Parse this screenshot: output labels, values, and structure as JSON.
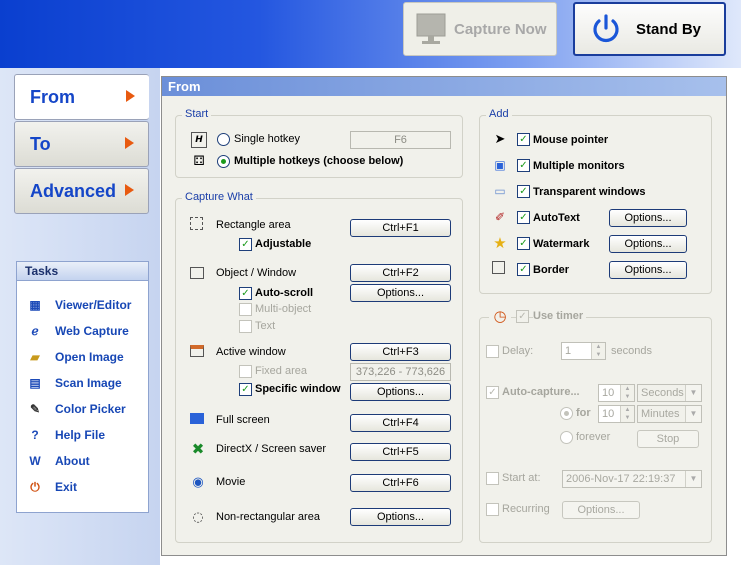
{
  "toolbar": {
    "capture_now": "Capture Now",
    "stand_by": "Stand By"
  },
  "nav": {
    "from": "From",
    "to": "To",
    "advanced": "Advanced"
  },
  "tasks": {
    "title": "Tasks",
    "items": [
      {
        "label": "Viewer/Editor",
        "icon": "viewer-icon"
      },
      {
        "label": "Web Capture",
        "icon": "web-icon"
      },
      {
        "label": "Open Image",
        "icon": "folder-icon"
      },
      {
        "label": "Scan Image",
        "icon": "scanner-icon"
      },
      {
        "label": "Color Picker",
        "icon": "dropper-icon"
      },
      {
        "label": "Help File",
        "icon": "help-icon"
      },
      {
        "label": "About",
        "icon": "about-icon"
      },
      {
        "label": "Exit",
        "icon": "exit-icon"
      }
    ]
  },
  "panel": {
    "title": "From"
  },
  "start": {
    "title": "Start",
    "single_hotkey": "Single hotkey",
    "single_value": "F6",
    "multiple_hotkeys": "Multiple hotkeys  (choose below)"
  },
  "capture": {
    "title": "Capture What",
    "rectangle": "Rectangle area",
    "rectangle_key": "Ctrl+F1",
    "adjustable": "Adjustable",
    "object": "Object / Window",
    "object_key": "Ctrl+F2",
    "auto_scroll": "Auto-scroll",
    "options": "Options...",
    "multi_object": "Multi-object",
    "text": "Text",
    "active": "Active window",
    "active_key": "Ctrl+F3",
    "fixed_area": "Fixed area",
    "fixed_value": "373,226 - 773,626",
    "specific_window": "Specific window",
    "full_screen": "Full screen",
    "full_key": "Ctrl+F4",
    "directx": "DirectX / Screen saver",
    "directx_key": "Ctrl+F5",
    "movie": "Movie",
    "movie_key": "Ctrl+F6",
    "nonrect": "Non-rectangular area"
  },
  "add": {
    "title": "Add",
    "mouse_pointer": "Mouse pointer",
    "multiple_monitors": "Multiple monitors",
    "transparent_windows": "Transparent windows",
    "autotext": "AutoText",
    "watermark": "Watermark",
    "border": "Border",
    "options": "Options..."
  },
  "timer": {
    "use_timer": "Use timer",
    "delay": "Delay:",
    "delay_value": "1",
    "seconds": "seconds",
    "auto_capture": "Auto-capture...",
    "auto_value": "10",
    "auto_unit": "Seconds",
    "for": "for",
    "for_value": "10",
    "for_unit": "Minutes",
    "forever": "forever",
    "stop": "Stop",
    "start_at": "Start at:",
    "start_value": "2006-Nov-17 22:19:37",
    "recurring": "Recurring",
    "options": "Options..."
  }
}
